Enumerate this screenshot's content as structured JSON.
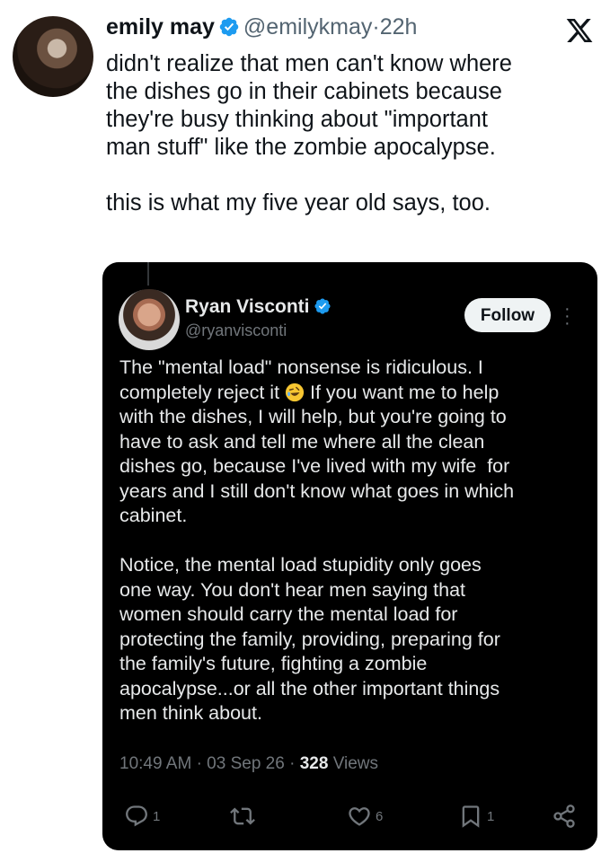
{
  "tweet": {
    "author_name": "emily may",
    "author_handle": "@emilykmay",
    "separator": "·",
    "time_ago": "22h",
    "text": "didn't realize that men can't know where\nthe dishes go in their cabinets because\nthey're busy thinking about \"important\nman stuff\" like the zombie apocalypse.\n\nthis is what my five year old says, too."
  },
  "quoted": {
    "author_name": "Ryan Visconti",
    "author_handle": "@ryanvisconti",
    "follow_label": "Follow",
    "body_part1": "The \"mental load\" nonsense is ridiculous. I\ncompletely reject it ",
    "body_part2": " If you want me to help\nwith the dishes, I will help, but you're going to\nhave to ask and tell me where all the clean\ndishes go, because I've lived with my wife  for\nyears and I still don't know what goes in which\ncabinet.\n\nNotice, the mental load stupidity only goes\none way. You don't hear men saying that\nwomen should carry the mental load for\nprotecting the family, providing, preparing for\nthe family's future, fighting a zombie\napocalypse...or all the other important things\nmen think about.",
    "emoji": "rolling-on-floor-laughing-emoji",
    "meta_time": "10:49 AM",
    "meta_date": "03 Sep 26",
    "meta_views_count": "328",
    "meta_views_label": "Views",
    "meta_sep": "·",
    "actions": {
      "reply_count": "1",
      "retweet_count": "",
      "like_count": "6",
      "bookmark_count": "1"
    }
  },
  "icons": {
    "verified": "verified-badge-icon",
    "logo": "x-logo-icon",
    "reply": "reply-icon",
    "retweet": "retweet-icon",
    "like": "heart-icon",
    "bookmark": "bookmark-icon",
    "share": "share-icon"
  },
  "colors": {
    "verified_blue": "#1d9bf0",
    "card_bg": "#000000",
    "text_dark": "#0f1419",
    "muted": "#536471"
  }
}
